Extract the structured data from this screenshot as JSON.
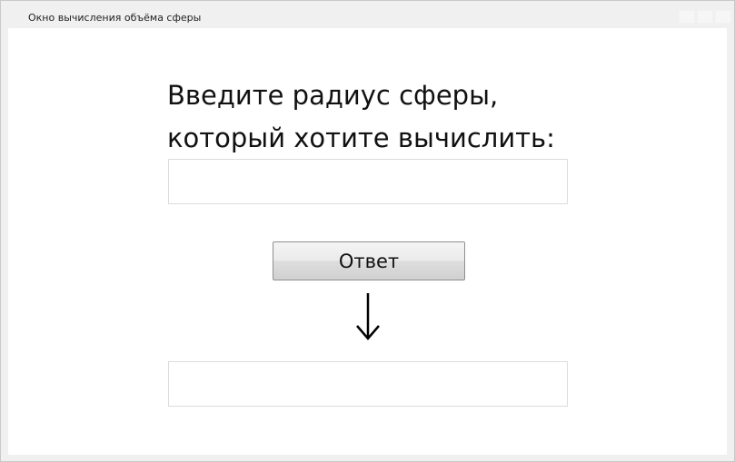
{
  "window": {
    "title": "Окно вычисления объёма сферы"
  },
  "form": {
    "prompt_line1": "Введите радиус сферы,",
    "prompt_line2": "который хотите вычислить:",
    "radius_value": "",
    "answer_button_label": "Ответ",
    "result_value": ""
  },
  "icons": {
    "arrow": "arrow-down-icon"
  }
}
